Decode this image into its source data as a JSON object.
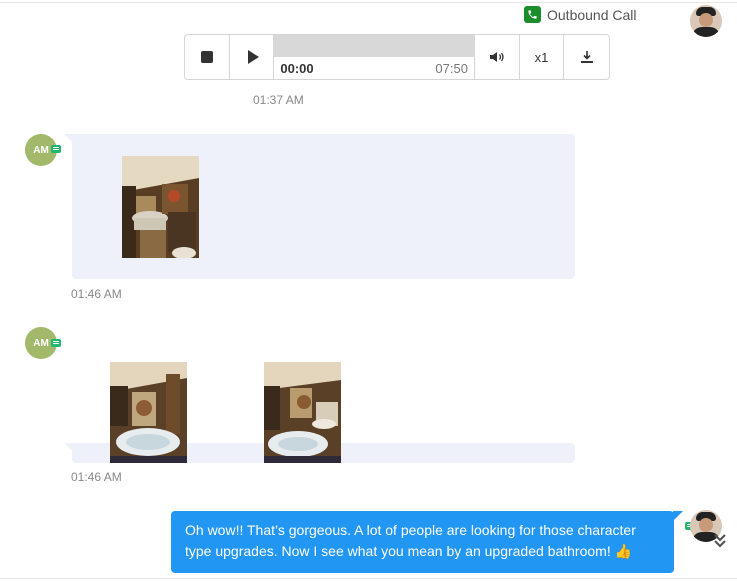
{
  "call": {
    "label": "Outbound Call",
    "icon": "phone-icon",
    "accent": "#1b8e2b"
  },
  "player": {
    "current_time": "00:00",
    "total_time": "07:50",
    "speed": "x1",
    "progress": 0
  },
  "call_timestamp": "01:37 AM",
  "messages": [
    {
      "direction": "in",
      "avatar_initials": "AM",
      "attachments": 1,
      "timestamp": "01:46 AM"
    },
    {
      "direction": "in",
      "avatar_initials": "AM",
      "attachments": 2,
      "timestamp": "01:46 AM"
    },
    {
      "direction": "out",
      "text": "Oh wow!! That’s gorgeous. A lot of people are looking for those character type upgrades. Now I see what you mean by an upgraded bathroom! 👍"
    }
  ],
  "colors": {
    "incoming_bubble": "#eef1f9",
    "outgoing_bubble": "#2196f3",
    "avatar": "#a2b86a",
    "sms_badge": "#1fb86d"
  }
}
